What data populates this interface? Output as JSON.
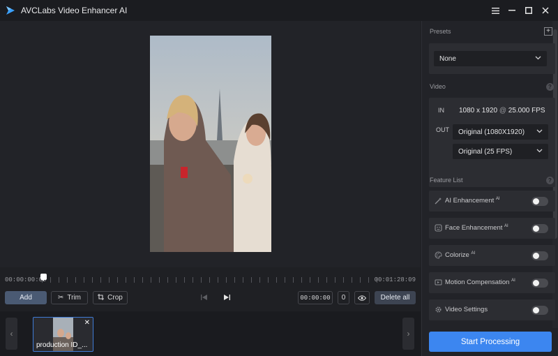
{
  "titlebar": {
    "title": "AVCLabs Video Enhancer AI",
    "menu_icon": "hamburger-menu-icon",
    "minimize_icon": "minimize-icon",
    "maximize_icon": "maximize-icon",
    "close_icon": "close-icon"
  },
  "timeline": {
    "current_time": "00:00:00:00",
    "end_time": "00:01:28:09"
  },
  "toolbar": {
    "add_label": "Add",
    "trim_label": "Trim",
    "crop_label": "Crop",
    "time_value": "00:00:00",
    "count_value": "0",
    "delete_all_label": "Delete all"
  },
  "filmstrip": {
    "items": [
      {
        "name": "production ID_..."
      }
    ]
  },
  "panel": {
    "presets_label": "Presets",
    "preset_value": "None",
    "video_label": "Video",
    "in_tag": "IN",
    "input_resolution": "1080 x 1920",
    "input_at": "@",
    "input_fps": "25.000",
    "input_fps_unit": "FPS",
    "out_tag": "OUT",
    "output_resolution": "Original (1080X1920)",
    "output_fps": "Original (25 FPS)",
    "feature_list_label": "Feature List",
    "features": [
      {
        "label": "AI Enhancement",
        "sup": "AI",
        "icon": "magic-wand-icon",
        "enabled": false
      },
      {
        "label": "Face Enhancement",
        "sup": "AI",
        "icon": "face-icon",
        "enabled": false
      },
      {
        "label": "Colorize",
        "sup": "AI",
        "icon": "palette-icon",
        "enabled": false
      },
      {
        "label": "Motion Compensation",
        "sup": "AI",
        "icon": "motion-icon",
        "enabled": false
      },
      {
        "label": "Video Settings",
        "sup": "",
        "icon": "gear-icon",
        "enabled": false
      }
    ],
    "start_label": "Start Processing"
  },
  "colors": {
    "accent": "#3c86f0",
    "background": "#1e1f23",
    "panel": "#222328",
    "card": "#2c2d32"
  }
}
